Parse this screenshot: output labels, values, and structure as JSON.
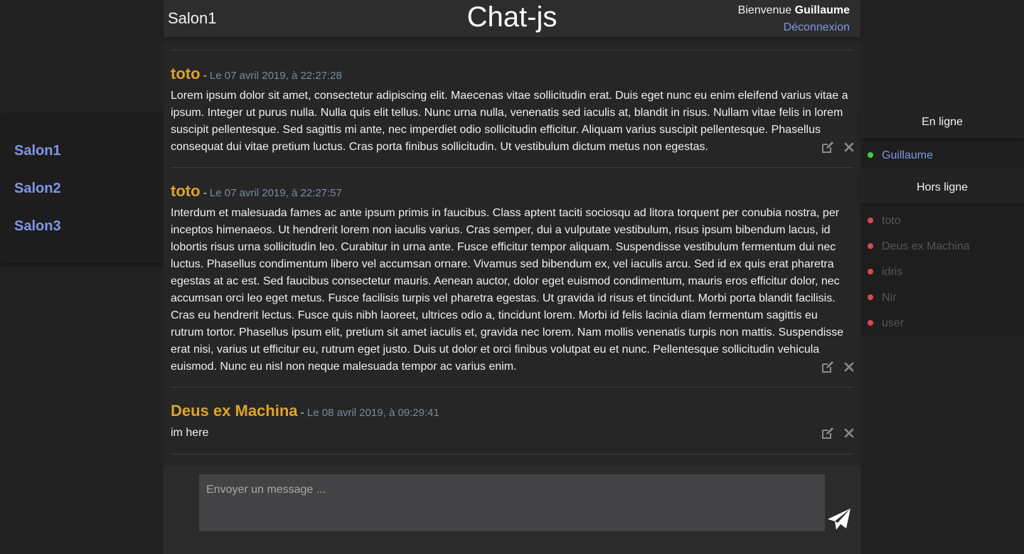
{
  "header": {
    "room_title": "Salon1",
    "app_title": "Chat-js",
    "welcome_prefix": "Bienvenue",
    "username": "Guillaume",
    "logout_label": "Déconnexion"
  },
  "rooms": [
    {
      "label": "Salon1"
    },
    {
      "label": "Salon2"
    },
    {
      "label": "Salon3"
    }
  ],
  "messages": [
    {
      "author": "toto",
      "separator": " - ",
      "date": "Le 07 avril 2019, à 22:27:28",
      "text": "Lorem ipsum dolor sit amet, consectetur adipiscing elit. Maecenas vitae sollicitudin erat. Duis eget nunc eu enim eleifend varius vitae a ipsum. Integer ut purus nulla. Nulla quis elit tellus. Nunc urna nulla, venenatis sed iaculis at, blandit in risus. Nullam vitae felis in lorem suscipit pellentesque. Sed sagittis mi ante, nec imperdiet odio sollicitudin efficitur. Aliquam varius suscipit pellentesque. Phasellus consequat dui vitae pretium luctus. Cras porta finibus sollicitudin. Ut vestibulum dictum metus non egestas."
    },
    {
      "author": "toto",
      "separator": " - ",
      "date": "Le 07 avril 2019, à 22:27:57",
      "text": "Interdum et malesuada fames ac ante ipsum primis in faucibus. Class aptent taciti sociosqu ad litora torquent per conubia nostra, per inceptos himenaeos. Ut hendrerit lorem non iaculis varius. Cras semper, dui a vulputate vestibulum, risus ipsum bibendum lacus, id lobortis risus urna sollicitudin leo. Curabitur in urna ante. Fusce efficitur tempor aliquam. Suspendisse vestibulum fermentum dui nec luctus. Phasellus condimentum libero vel accumsan ornare. Vivamus sed bibendum ex, vel iaculis arcu. Sed id ex quis erat pharetra egestas at ac est. Sed faucibus consectetur mauris. Aenean auctor, dolor eget euismod condimentum, mauris eros efficitur dolor, nec accumsan orci leo eget metus. Fusce facilisis turpis vel pharetra egestas. Ut gravida id risus et tincidunt. Morbi porta blandit facilisis. Cras eu hendrerit lectus. Fusce quis nibh laoreet, ultrices odio a, tincidunt lorem. Morbi id felis lacinia diam fermentum sagittis eu rutrum tortor. Phasellus ipsum elit, pretium sit amet iaculis et, gravida nec lorem. Nam mollis venenatis turpis non mattis. Suspendisse erat nisi, varius ut efficitur eu, rutrum eget justo. Duis ut dolor et orci finibus volutpat eu et nunc. Pellentesque sollicitudin vehicula euismod. Nunc eu nisl non neque malesuada tempor ac varius enim."
    },
    {
      "author": "Deus ex Machina",
      "separator": " - ",
      "date": "Le 08 avril 2019, à 09:29:41",
      "text": "im here"
    }
  ],
  "composer": {
    "placeholder": "Envoyer un message ..."
  },
  "users": {
    "online_title": "En ligne",
    "offline_title": "Hors ligne",
    "online": [
      {
        "name": "Guillaume"
      }
    ],
    "offline": [
      {
        "name": "toto"
      },
      {
        "name": "Deus ex Machina"
      },
      {
        "name": "idris"
      },
      {
        "name": "Nir"
      },
      {
        "name": "user"
      }
    ]
  },
  "colors": {
    "link": "#7f97e6",
    "author": "#dfa429",
    "date": "#7c8a99",
    "online_dot": "#3fcf3f",
    "offline_dot": "#d94a4a",
    "offline_name": "#555555"
  },
  "icons": {
    "edit": "edit-icon",
    "delete": "close-icon",
    "send": "paper-plane-icon"
  }
}
